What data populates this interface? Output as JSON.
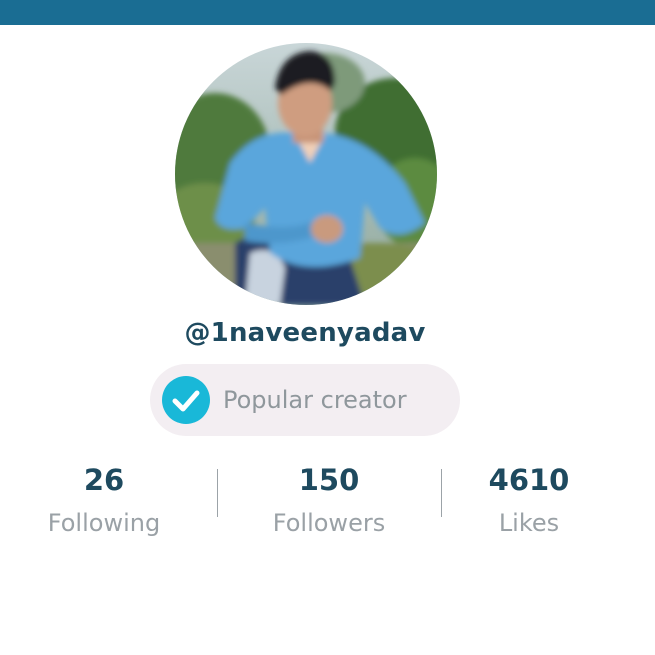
{
  "colors": {
    "top_bar": "#1a6d93",
    "username": "#1e4a5f",
    "badge_background": "#f3eef2",
    "badge_check": "#19b8d8",
    "stat_value": "#1e4a5f",
    "stat_label": "#9aa1a6"
  },
  "profile": {
    "avatar_icon": "profile-photo",
    "username": "@1naveenyadav",
    "badge": {
      "icon": "check-circle-icon",
      "label": "Popular creator"
    }
  },
  "stats": [
    {
      "value": "26",
      "label": "Following"
    },
    {
      "value": "150",
      "label": "Followers"
    },
    {
      "value": "4610",
      "label": "Likes"
    }
  ]
}
